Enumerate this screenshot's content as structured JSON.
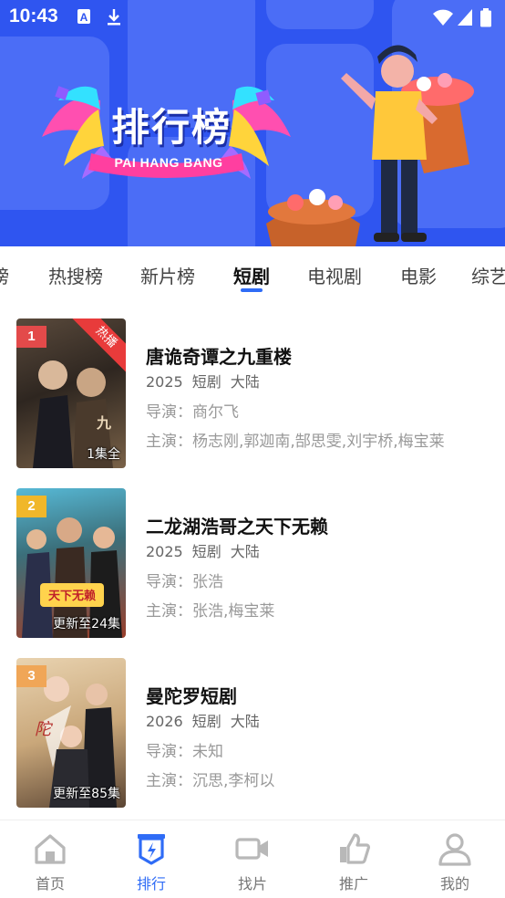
{
  "status_bar": {
    "time": "10:43",
    "left_icons": [
      "font-download-icon",
      "download-icon"
    ],
    "right_icons": [
      "wifi-icon",
      "cellular-signal-icon",
      "battery-icon"
    ]
  },
  "banner": {
    "title": "排行榜",
    "subtitle": "PAI HANG BANG",
    "background_color": "#2f55f0"
  },
  "tabs": [
    {
      "label": "榜",
      "active": false
    },
    {
      "label": "热搜榜",
      "active": false
    },
    {
      "label": "新片榜",
      "active": false
    },
    {
      "label": "短剧",
      "active": true
    },
    {
      "label": "电视剧",
      "active": false
    },
    {
      "label": "电影",
      "active": false
    },
    {
      "label": "综艺",
      "active": false
    }
  ],
  "accent_color": "#2f6cf6",
  "items": [
    {
      "rank": "1",
      "rank_color": "#e34a4a",
      "badge": "热播",
      "episodes": "1集全",
      "title": "唐诡奇谭之九重楼",
      "year": "2025",
      "genre": "短剧",
      "region": "大陆",
      "director": "导演：商尔飞",
      "cast": "主演：杨志刚,郭迦南,郜思雯,刘宇桥,梅宝莱"
    },
    {
      "rank": "2",
      "rank_color": "#f0b72a",
      "badge": "",
      "episodes": "更新至24集",
      "title": "二龙湖浩哥之天下无赖",
      "year": "2025",
      "genre": "短剧",
      "region": "大陆",
      "director": "导演：张浩",
      "cast": "主演：张浩,梅宝莱"
    },
    {
      "rank": "3",
      "rank_color": "#f0a657",
      "badge": "",
      "episodes": "更新至85集",
      "title": "曼陀罗短剧",
      "year": "2026",
      "genre": "短剧",
      "region": "大陆",
      "director": "导演：未知",
      "cast": "主演：沉思,李柯以"
    }
  ],
  "bottom_nav": [
    {
      "label": "首页",
      "icon": "home-icon",
      "active": false
    },
    {
      "label": "排行",
      "icon": "ranking-icon",
      "active": true
    },
    {
      "label": "找片",
      "icon": "video-camera-icon",
      "active": false
    },
    {
      "label": "推广",
      "icon": "thumbs-up-icon",
      "active": false
    },
    {
      "label": "我的",
      "icon": "user-icon",
      "active": false
    }
  ]
}
